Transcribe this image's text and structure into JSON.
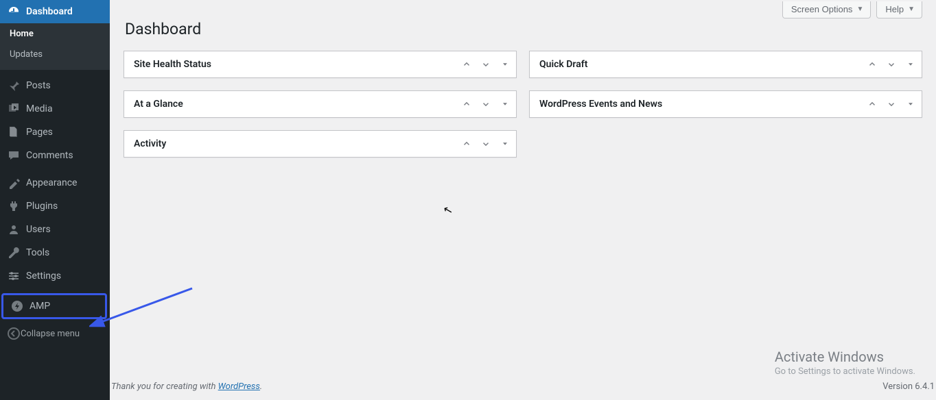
{
  "topbar": {
    "screen_options": "Screen Options",
    "help": "Help"
  },
  "page_title": "Dashboard",
  "sidebar": {
    "dashboard": "Dashboard",
    "sub_home": "Home",
    "sub_updates": "Updates",
    "posts": "Posts",
    "media": "Media",
    "pages": "Pages",
    "comments": "Comments",
    "appearance": "Appearance",
    "plugins": "Plugins",
    "users": "Users",
    "tools": "Tools",
    "settings": "Settings",
    "amp": "AMP",
    "collapse": "Collapse menu"
  },
  "boxes": {
    "site_health": "Site Health Status",
    "at_a_glance": "At a Glance",
    "activity": "Activity",
    "quick_draft": "Quick Draft",
    "events": "WordPress Events and News"
  },
  "footer": {
    "thanks_prefix": "Thank you for creating with ",
    "thanks_link": "WordPress",
    "thanks_suffix": ".",
    "version": "Version 6.4.1"
  },
  "watermark": {
    "line1": "Activate Windows",
    "line2": "Go to Settings to activate Windows."
  }
}
